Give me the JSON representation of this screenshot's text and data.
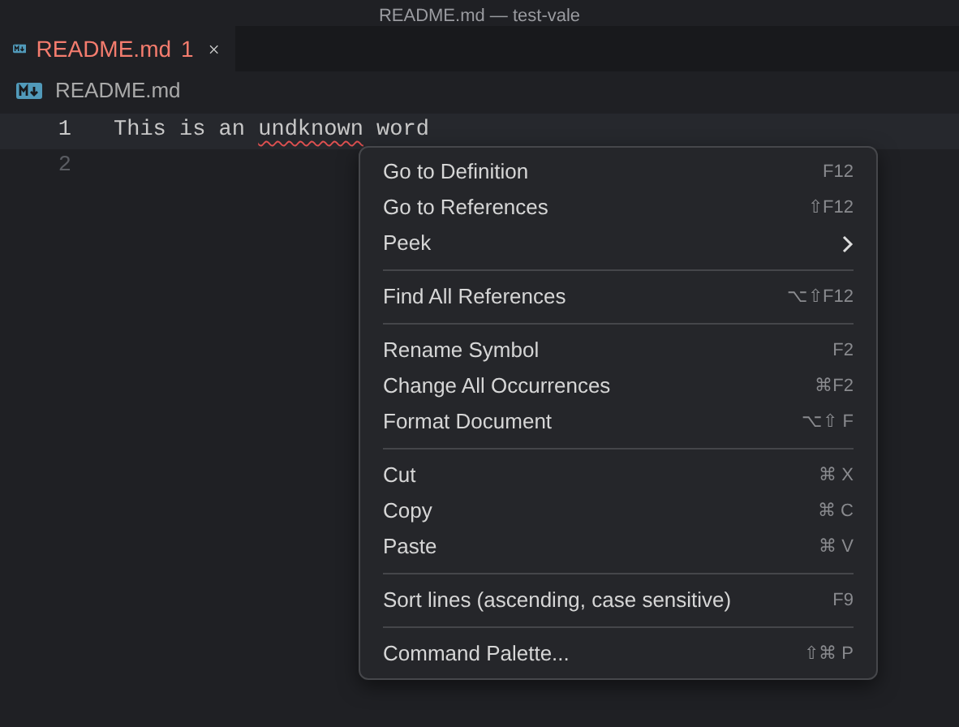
{
  "window": {
    "title": "README.md — test-vale"
  },
  "tabs": [
    {
      "label": "README.md",
      "problems": "1",
      "selected": true
    }
  ],
  "breadcrumb": "README.md",
  "editor": {
    "lines": [
      {
        "number": "1",
        "selected": true,
        "segments": [
          {
            "text": "This is an "
          },
          {
            "text": "undknown",
            "squiggle": true
          },
          {
            "text": " word"
          }
        ]
      },
      {
        "number": "2",
        "selected": false
      }
    ]
  },
  "context_menu": {
    "groups": [
      [
        {
          "label": "Go to Definition",
          "shortcut": "F12"
        },
        {
          "label": "Go to References",
          "shortcut": "⇧F12"
        },
        {
          "label": "Peek",
          "submenu": true
        }
      ],
      [
        {
          "label": "Find All References",
          "shortcut": "⌥⇧F12"
        }
      ],
      [
        {
          "label": "Rename Symbol",
          "shortcut": "F2"
        },
        {
          "label": "Change All Occurrences",
          "shortcut": "⌘F2"
        },
        {
          "label": "Format Document",
          "shortcut": "⌥⇧ F"
        }
      ],
      [
        {
          "label": "Cut",
          "shortcut": "⌘ X"
        },
        {
          "label": "Copy",
          "shortcut": "⌘ C"
        },
        {
          "label": "Paste",
          "shortcut": "⌘ V"
        }
      ],
      [
        {
          "label": "Sort lines (ascending, case sensitive)",
          "shortcut": "F9"
        }
      ],
      [
        {
          "label": "Command Palette...",
          "shortcut": "⇧⌘ P"
        }
      ]
    ]
  }
}
